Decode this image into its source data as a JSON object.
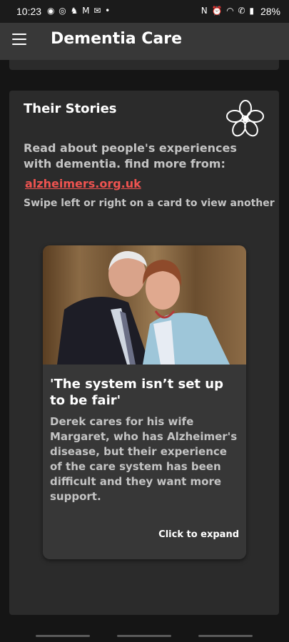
{
  "status_bar": {
    "time": "10:23",
    "battery": "28%",
    "left_icons": "◉ ◎ ♞ M ✉ •",
    "right_icons": "N ⏰ ◠ ✆ ▮"
  },
  "app_bar": {
    "title": "Dementia Care",
    "menu_icon": "hamburger-menu-icon"
  },
  "section": {
    "title": "Their Stories",
    "logo_icon": "alzheimers-society-logo",
    "intro": "Read about people's experiences with dementia. find more from:",
    "link": "alzheimers.org.uk",
    "swipe_hint": "Swipe left or right on a card to view another"
  },
  "story": {
    "title": "'The system isn’t set up to be fair'",
    "body": "Derek cares for his wife Margaret, who has Alzheimer's disease, but their experience of the care system has been difficult and they want more support.",
    "expand": "Click to expand"
  },
  "colors": {
    "background": "#151515",
    "app_bar": "#383838",
    "card": "#2b2b2b",
    "story_card": "#373737",
    "link": "#ef5350",
    "muted_text": "#c4c4c4"
  }
}
